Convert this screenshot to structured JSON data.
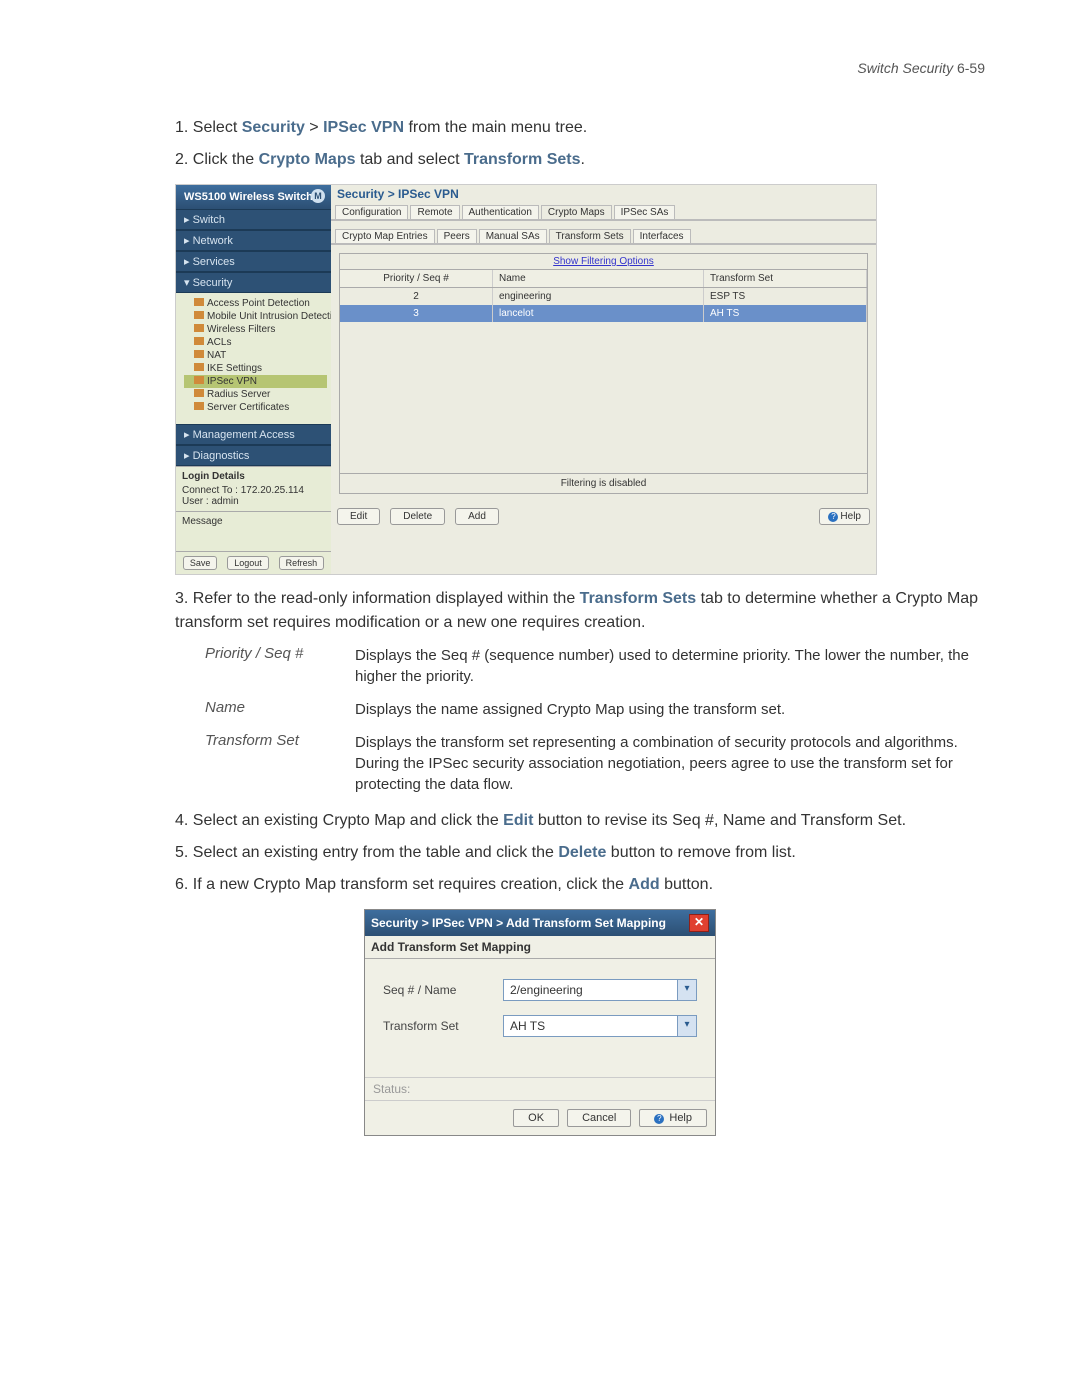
{
  "header": {
    "title_italic": "Switch Security",
    "page_ref": "6-59"
  },
  "step1": {
    "num": "1.",
    "a": "Select ",
    "b": "Security",
    "gt": " > ",
    "c": "IPSec VPN",
    "d": " from the main menu tree."
  },
  "step2": {
    "num": "2.",
    "a": "Click the ",
    "b": "Crypto Maps",
    "c": " tab and select ",
    "d": "Transform Sets",
    "e": "."
  },
  "shot1": {
    "product": "WS5100 Wireless Switch",
    "side_sections": {
      "switch": "▸ Switch",
      "network": "▸ Network",
      "services": "▸ Services",
      "security": "▾ Security",
      "mgmt": "▸ Management Access",
      "diag": "▸ Diagnostics"
    },
    "tree": {
      "i0": "Access Point Detection",
      "i1": "Mobile Unit Intrusion Detection",
      "i2": "Wireless Filters",
      "i3": "ACLs",
      "i4": "NAT",
      "i5": "IKE Settings",
      "i6": "IPSec VPN",
      "i7": "Radius Server",
      "i8": "Server Certificates"
    },
    "login": {
      "hdr": "Login Details",
      "l1a": "Connect To :",
      "l1b": "172.20.25.114",
      "l2a": "User :",
      "l2b": "admin"
    },
    "msg_hdr": "Message",
    "footer": {
      "save": "Save",
      "logout": "Logout",
      "refresh": "Refresh"
    },
    "crumb": "Security > IPSec VPN",
    "tabs1": {
      "t0": "Configuration",
      "t1": "Remote",
      "t2": "Authentication",
      "t3": "Crypto Maps",
      "t4": "IPSec SAs"
    },
    "tabs2": {
      "t0": "Crypto Map Entries",
      "t1": "Peers",
      "t2": "Manual SAs",
      "t3": "Transform Sets",
      "t4": "Interfaces"
    },
    "show_filter": "Show Filtering Options",
    "grid_head": {
      "c1": "Priority / Seq #",
      "c2": "Name",
      "c3": "Transform Set"
    },
    "rows": [
      {
        "seq": "2",
        "name": "engineering",
        "ts": "ESP TS"
      },
      {
        "seq": "3",
        "name": "lancelot",
        "ts": "AH TS"
      }
    ],
    "filter_status": "Filtering is disabled",
    "actions": {
      "edit": "Edit",
      "del": "Delete",
      "add": "Add",
      "help": "Help"
    }
  },
  "step3": {
    "num": "3.",
    "a": "Refer to the read-only information displayed within the ",
    "b": "Transform Sets",
    "c": " tab to determine whether a Crypto Map transform set requires modification or a new one requires creation."
  },
  "desc": {
    "r0": {
      "k": "Priority / Seq #",
      "v": "Displays the Seq # (sequence number) used to determine priority. The lower the number, the higher the priority."
    },
    "r1": {
      "k": "Name",
      "v": "Displays the name assigned Crypto Map using the transform set."
    },
    "r2": {
      "k": "Transform Set",
      "v": "Displays the transform set representing a combination of security protocols and algorithms. During the IPSec security association negotiation, peers agree to use the transform set for protecting the data flow."
    }
  },
  "step4": {
    "num": "4.",
    "a": "Select an existing Crypto Map and click the ",
    "b": "Edit",
    "c": " button to revise its Seq #, Name and Transform Set."
  },
  "step5": {
    "num": "5.",
    "a": "Select an existing entry from the table and click the ",
    "b": "Delete",
    "c": " button to remove from list."
  },
  "step6": {
    "num": "6.",
    "a": "If a new Crypto Map transform set requires creation, click the ",
    "b": "Add",
    "c": " button."
  },
  "shot2": {
    "title": "Security > IPSec VPN > Add Transform Set Mapping",
    "close": "✕",
    "sub": "Add Transform Set Mapping",
    "f1_label": "Seq # / Name",
    "f1_value": "2/engineering",
    "f2_label": "Transform Set",
    "f2_value": "AH TS",
    "status": "Status:",
    "ok": "OK",
    "cancel": "Cancel",
    "help": "Help"
  }
}
